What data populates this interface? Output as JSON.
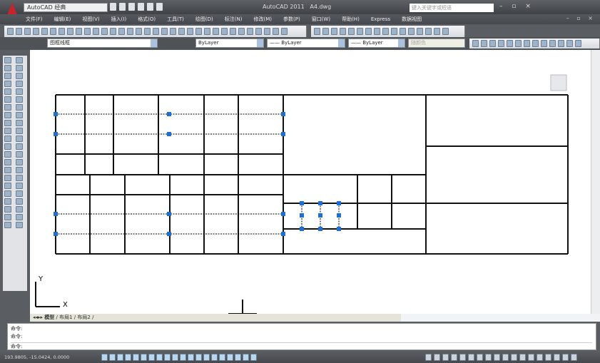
{
  "app": {
    "title": "AutoCAD 2011",
    "document": "A4.dwg",
    "workspace": "AutoCAD 经典",
    "search_placeholder": "键入关键字或短语",
    "window_controls": "– ▫ ×",
    "mdi_controls": "– ▫ ×"
  },
  "menu": [
    "文件(F)",
    "编辑(E)",
    "视图(V)",
    "插入(I)",
    "格式(O)",
    "工具(T)",
    "绘图(D)",
    "标注(N)",
    "修改(M)",
    "参数(P)",
    "窗口(W)",
    "帮助(H)",
    "Express",
    "数据视图"
  ],
  "properties": {
    "layer": "图框线框",
    "color": "ByLayer",
    "linetype": "—— ByLayer",
    "lineweight": "—— ByLayer",
    "plotstyle": "随颜色"
  },
  "tabs": {
    "nav": "◂◂▸▸",
    "model": "模型",
    "layout1": "布局1",
    "layout2": "布局2"
  },
  "command": {
    "line1": "命令:",
    "line2": "命令:",
    "prompt": "命令:"
  },
  "status": {
    "coords": "193.9805, -15.0424, 0.0000"
  },
  "ucs": {
    "x": "X",
    "y": "Y"
  },
  "colors": {
    "accent": "#c8232b",
    "grip": "#1f6fd1",
    "line": "#111111"
  }
}
